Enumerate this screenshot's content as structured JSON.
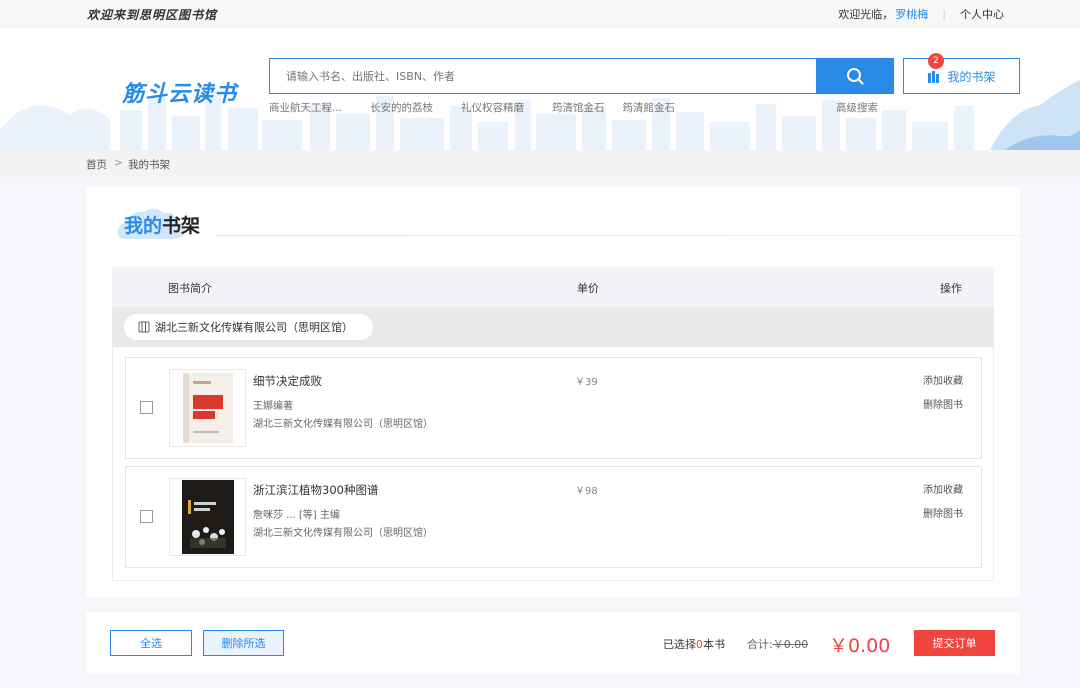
{
  "topbar": {
    "welcome": "欢迎来到思明区图书馆",
    "greeting": "欢迎光临，",
    "username": "罗桃梅",
    "personal_center": "个人中心"
  },
  "header": {
    "logo": "筋斗云读书",
    "search_placeholder": "请输入书名、出版社、ISBN、作者",
    "hot_words": [
      "商业航天工程...",
      "长安的的荔枝",
      "礼仪权容精磨",
      "筠清馆金石",
      "筠清館金石"
    ],
    "advanced_search": "高级搜索",
    "shelf_label": "我的书架",
    "shelf_count": "2"
  },
  "breadcrumb": {
    "home": "首页",
    "separator": ">",
    "current": "我的书架"
  },
  "shelf": {
    "title_prefix": "我的",
    "title_suffix": "书架",
    "columns": {
      "intro": "图书简介",
      "price": "单价",
      "action": "操作"
    },
    "library": "湖北三新文化传媒有限公司（思明区馆）",
    "items": [
      {
        "name": "细节决定成败",
        "author": "王娜编著",
        "publisher": "湖北三新文化传媒有限公司（思明区馆）",
        "price": "￥39",
        "add_favorite": "添加收藏",
        "delete": "删除图书",
        "cover_text": "细节决定成败"
      },
      {
        "name": "浙江滨江植物300种图谱",
        "author": "詹咪莎 ... [等] 主编",
        "publisher": "湖北三新文化传媒有限公司（思明区馆）",
        "price": "￥98",
        "add_favorite": "添加收藏",
        "delete": "删除图书",
        "cover_text": "浙江滨江植物300种图谱"
      }
    ]
  },
  "footer": {
    "select_all": "全选",
    "delete_selected": "删除所选",
    "selected_prefix": "已选择",
    "selected_count": "0",
    "selected_suffix": "本书",
    "subtotal_label": "合计:",
    "subtotal_value": "￥0.00",
    "total": "￥0.00",
    "submit": "提交订单"
  },
  "colors": {
    "accent": "#2a8ae8",
    "danger": "#f0443f"
  }
}
